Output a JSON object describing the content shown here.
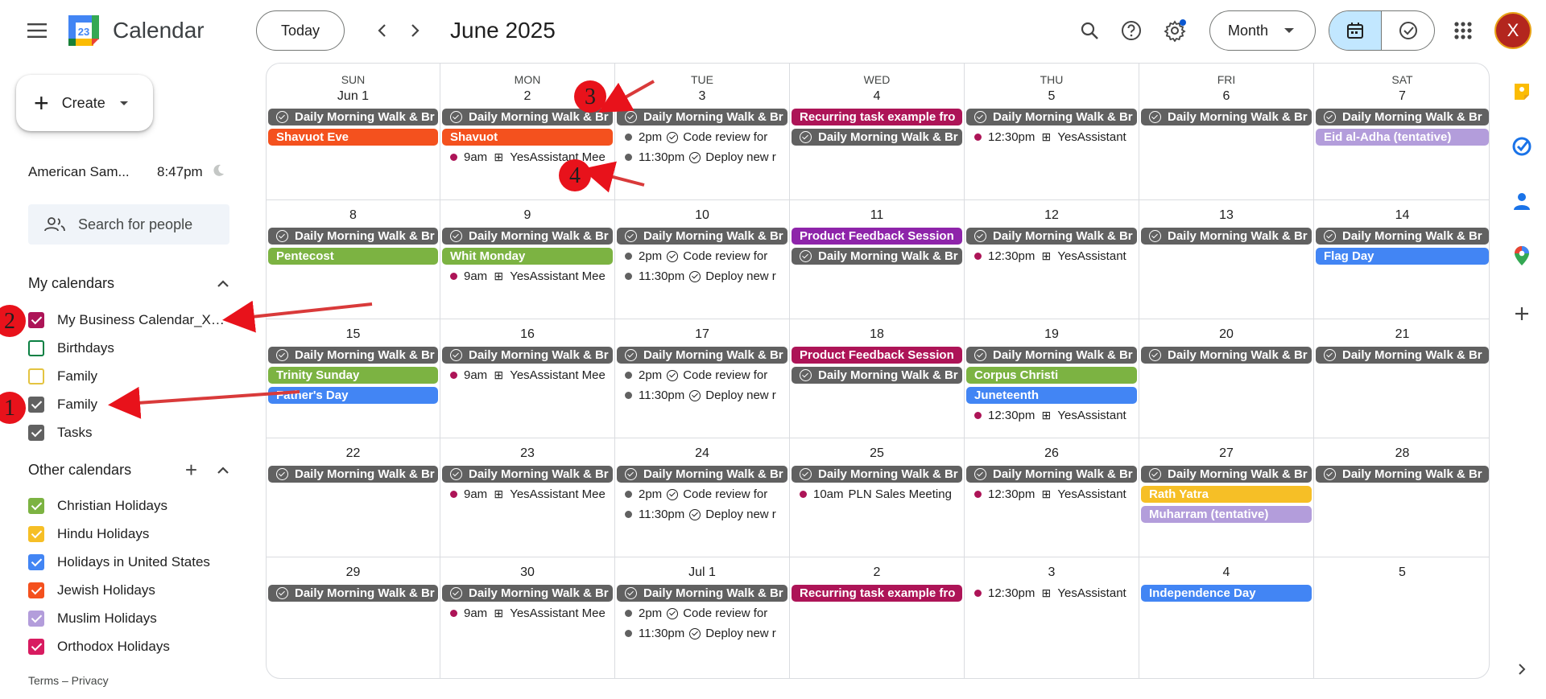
{
  "header": {
    "app_title": "Calendar",
    "logo_number": "23",
    "today_label": "Today",
    "month_title": "June 2025",
    "view_label": "Month",
    "avatar_letter": "X",
    "accent": "#0b57d0"
  },
  "sidebar": {
    "create_label": "Create",
    "timezone_name": "American Sam...",
    "timezone_time": "8:47pm",
    "people_search_placeholder": "Search for people",
    "my_calendars_title": "My calendars",
    "my_calendars": [
      {
        "label": "My Business Calendar_Xe...",
        "color": "#ad1457",
        "checked": true
      },
      {
        "label": "Birthdays",
        "color": "#0b8043",
        "checked": false
      },
      {
        "label": "Family",
        "color": "#e4c441",
        "checked": false
      },
      {
        "label": "Family",
        "color": "#616161",
        "checked": true
      },
      {
        "label": "Tasks",
        "color": "#616161",
        "checked": true
      }
    ],
    "other_calendars_title": "Other calendars",
    "other_calendars": [
      {
        "label": "Christian Holidays",
        "color": "#7cb342",
        "checked": true
      },
      {
        "label": "Hindu Holidays",
        "color": "#f6bf26",
        "checked": true
      },
      {
        "label": "Holidays in United States",
        "color": "#4285f4",
        "checked": true
      },
      {
        "label": "Jewish Holidays",
        "color": "#f4511e",
        "checked": true
      },
      {
        "label": "Muslim Holidays",
        "color": "#b39ddb",
        "checked": true
      },
      {
        "label": "Orthodox Holidays",
        "color": "#d81b60",
        "checked": true
      }
    ],
    "footer": "Terms – Privacy"
  },
  "calendar": {
    "weekdays": [
      "SUN",
      "MON",
      "TUE",
      "WED",
      "THU",
      "FRI",
      "SAT"
    ],
    "colors": {
      "task": "#616161",
      "business": "#ad1457",
      "purple": "#8e24aa",
      "orange": "#f4511e",
      "green": "#7cb342",
      "blue": "#4285f4",
      "yellow": "#f6bf26",
      "lavender": "#b39ddb"
    },
    "weeks": [
      [
        {
          "date": "Jun 1",
          "events": [
            {
              "kind": "task",
              "title": "Daily Morning Walk & Br",
              "color": "task"
            },
            {
              "kind": "bar",
              "title": "Shavuot Eve",
              "color": "orange"
            }
          ]
        },
        {
          "date": "2",
          "events": [
            {
              "kind": "task",
              "title": "Daily Morning Walk & Br",
              "color": "task"
            },
            {
              "kind": "bar",
              "title": "Shavuot",
              "color": "orange"
            },
            {
              "kind": "timed",
              "time": "9am",
              "glyph": "grid",
              "title": "YesAssistant Mee",
              "color": "business"
            }
          ]
        },
        {
          "date": "3",
          "events": [
            {
              "kind": "task",
              "title": "Daily Morning Walk & Br",
              "color": "task"
            },
            {
              "kind": "timed",
              "time": "2pm",
              "glyph": "check",
              "title": "Code review for",
              "color": "task"
            },
            {
              "kind": "timed",
              "time": "11:30pm",
              "glyph": "check",
              "title": "Deploy new r",
              "color": "task"
            }
          ]
        },
        {
          "date": "4",
          "events": [
            {
              "kind": "bar",
              "title": "Recurring task example fro",
              "color": "business"
            },
            {
              "kind": "task",
              "title": "Daily Morning Walk & Br",
              "color": "task"
            }
          ]
        },
        {
          "date": "5",
          "events": [
            {
              "kind": "task",
              "title": "Daily Morning Walk & Br",
              "color": "task"
            },
            {
              "kind": "timed",
              "time": "12:30pm",
              "glyph": "grid",
              "title": "YesAssistant",
              "color": "business"
            }
          ]
        },
        {
          "date": "6",
          "events": [
            {
              "kind": "task",
              "title": "Daily Morning Walk & Br",
              "color": "task"
            }
          ]
        },
        {
          "date": "7",
          "events": [
            {
              "kind": "task",
              "title": "Daily Morning Walk & Br",
              "color": "task"
            },
            {
              "kind": "bar",
              "title": "Eid al-Adha (tentative)",
              "color": "lavender"
            }
          ]
        }
      ],
      [
        {
          "date": "8",
          "events": [
            {
              "kind": "task",
              "title": "Daily Morning Walk & Br",
              "color": "task"
            },
            {
              "kind": "bar",
              "title": "Pentecost",
              "color": "green"
            }
          ]
        },
        {
          "date": "9",
          "events": [
            {
              "kind": "task",
              "title": "Daily Morning Walk & Br",
              "color": "task"
            },
            {
              "kind": "bar",
              "title": "Whit Monday",
              "color": "green"
            },
            {
              "kind": "timed",
              "time": "9am",
              "glyph": "grid",
              "title": "YesAssistant Mee",
              "color": "business"
            }
          ]
        },
        {
          "date": "10",
          "events": [
            {
              "kind": "task",
              "title": "Daily Morning Walk & Br",
              "color": "task"
            },
            {
              "kind": "timed",
              "time": "2pm",
              "glyph": "check",
              "title": "Code review for",
              "color": "task"
            },
            {
              "kind": "timed",
              "time": "11:30pm",
              "glyph": "check",
              "title": "Deploy new r",
              "color": "task"
            }
          ]
        },
        {
          "date": "11",
          "events": [
            {
              "kind": "bar",
              "title": "Product Feedback Session",
              "color": "purple"
            },
            {
              "kind": "task",
              "title": "Daily Morning Walk & Br",
              "color": "task"
            }
          ]
        },
        {
          "date": "12",
          "events": [
            {
              "kind": "task",
              "title": "Daily Morning Walk & Br",
              "color": "task"
            },
            {
              "kind": "timed",
              "time": "12:30pm",
              "glyph": "grid",
              "title": "YesAssistant",
              "color": "business"
            }
          ]
        },
        {
          "date": "13",
          "events": [
            {
              "kind": "task",
              "title": "Daily Morning Walk & Br",
              "color": "task"
            }
          ]
        },
        {
          "date": "14",
          "events": [
            {
              "kind": "task",
              "title": "Daily Morning Walk & Br",
              "color": "task"
            },
            {
              "kind": "bar",
              "title": "Flag Day",
              "color": "blue"
            }
          ]
        }
      ],
      [
        {
          "date": "15",
          "events": [
            {
              "kind": "task",
              "title": "Daily Morning Walk & Br",
              "color": "task"
            },
            {
              "kind": "bar",
              "title": "Trinity Sunday",
              "color": "green"
            },
            {
              "kind": "bar",
              "title": "Father's Day",
              "color": "blue"
            }
          ]
        },
        {
          "date": "16",
          "events": [
            {
              "kind": "task",
              "title": "Daily Morning Walk & Br",
              "color": "task"
            },
            {
              "kind": "timed",
              "time": "9am",
              "glyph": "grid",
              "title": "YesAssistant Mee",
              "color": "business"
            }
          ]
        },
        {
          "date": "17",
          "events": [
            {
              "kind": "task",
              "title": "Daily Morning Walk & Br",
              "color": "task"
            },
            {
              "kind": "timed",
              "time": "2pm",
              "glyph": "check",
              "title": "Code review for",
              "color": "task"
            },
            {
              "kind": "timed",
              "time": "11:30pm",
              "glyph": "check",
              "title": "Deploy new r",
              "color": "task"
            }
          ]
        },
        {
          "date": "18",
          "events": [
            {
              "kind": "bar",
              "title": "Product Feedback Session",
              "color": "business"
            },
            {
              "kind": "task",
              "title": "Daily Morning Walk & Br",
              "color": "task"
            }
          ]
        },
        {
          "date": "19",
          "events": [
            {
              "kind": "task",
              "title": "Daily Morning Walk & Br",
              "color": "task"
            },
            {
              "kind": "bar",
              "title": "Corpus Christi",
              "color": "green"
            },
            {
              "kind": "bar",
              "title": "Juneteenth",
              "color": "blue"
            },
            {
              "kind": "timed",
              "time": "12:30pm",
              "glyph": "grid",
              "title": "YesAssistant",
              "color": "business"
            }
          ]
        },
        {
          "date": "20",
          "events": [
            {
              "kind": "task",
              "title": "Daily Morning Walk & Br",
              "color": "task"
            }
          ]
        },
        {
          "date": "21",
          "events": [
            {
              "kind": "task",
              "title": "Daily Morning Walk & Br",
              "color": "task"
            }
          ]
        }
      ],
      [
        {
          "date": "22",
          "events": [
            {
              "kind": "task",
              "title": "Daily Morning Walk & Br",
              "color": "task"
            }
          ]
        },
        {
          "date": "23",
          "events": [
            {
              "kind": "task",
              "title": "Daily Morning Walk & Br",
              "color": "task"
            },
            {
              "kind": "timed",
              "time": "9am",
              "glyph": "grid",
              "title": "YesAssistant Mee",
              "color": "business"
            }
          ]
        },
        {
          "date": "24",
          "events": [
            {
              "kind": "task",
              "title": "Daily Morning Walk & Br",
              "color": "task"
            },
            {
              "kind": "timed",
              "time": "2pm",
              "glyph": "check",
              "title": "Code review for",
              "color": "task"
            },
            {
              "kind": "timed",
              "time": "11:30pm",
              "glyph": "check",
              "title": "Deploy new r",
              "color": "task"
            }
          ]
        },
        {
          "date": "25",
          "events": [
            {
              "kind": "task",
              "title": "Daily Morning Walk & Br",
              "color": "task"
            },
            {
              "kind": "timed",
              "time": "10am",
              "glyph": "",
              "title": "PLN Sales Meeting",
              "color": "business"
            }
          ]
        },
        {
          "date": "26",
          "events": [
            {
              "kind": "task",
              "title": "Daily Morning Walk & Br",
              "color": "task"
            },
            {
              "kind": "timed",
              "time": "12:30pm",
              "glyph": "grid",
              "title": "YesAssistant",
              "color": "business"
            }
          ]
        },
        {
          "date": "27",
          "events": [
            {
              "kind": "task",
              "title": "Daily Morning Walk & Br",
              "color": "task"
            },
            {
              "kind": "bar",
              "title": "Rath Yatra",
              "color": "yellow"
            },
            {
              "kind": "bar",
              "title": "Muharram (tentative)",
              "color": "lavender"
            }
          ]
        },
        {
          "date": "28",
          "events": [
            {
              "kind": "task",
              "title": "Daily Morning Walk & Br",
              "color": "task"
            }
          ]
        }
      ],
      [
        {
          "date": "29",
          "events": [
            {
              "kind": "task",
              "title": "Daily Morning Walk & Br",
              "color": "task"
            }
          ]
        },
        {
          "date": "30",
          "events": [
            {
              "kind": "task",
              "title": "Daily Morning Walk & Br",
              "color": "task"
            },
            {
              "kind": "timed",
              "time": "9am",
              "glyph": "grid",
              "title": "YesAssistant Mee",
              "color": "business"
            }
          ]
        },
        {
          "date": "Jul 1",
          "events": [
            {
              "kind": "task",
              "title": "Daily Morning Walk & Br",
              "color": "task"
            },
            {
              "kind": "timed",
              "time": "2pm",
              "glyph": "check",
              "title": "Code review for",
              "color": "task"
            },
            {
              "kind": "timed",
              "time": "11:30pm",
              "glyph": "check",
              "title": "Deploy new r",
              "color": "task"
            }
          ]
        },
        {
          "date": "2",
          "events": [
            {
              "kind": "bar",
              "title": "Recurring task example fro",
              "color": "business"
            }
          ]
        },
        {
          "date": "3",
          "events": [
            {
              "kind": "timed",
              "time": "12:30pm",
              "glyph": "grid",
              "title": "YesAssistant",
              "color": "business"
            }
          ]
        },
        {
          "date": "4",
          "events": [
            {
              "kind": "bar",
              "title": "Independence Day",
              "color": "blue"
            }
          ]
        },
        {
          "date": "5",
          "events": []
        }
      ]
    ]
  },
  "annotations": [
    {
      "number": "1",
      "color": "#e8121b"
    },
    {
      "number": "2",
      "color": "#e8121b"
    },
    {
      "number": "3",
      "color": "#e8121b"
    },
    {
      "number": "4",
      "color": "#e8121b"
    }
  ]
}
